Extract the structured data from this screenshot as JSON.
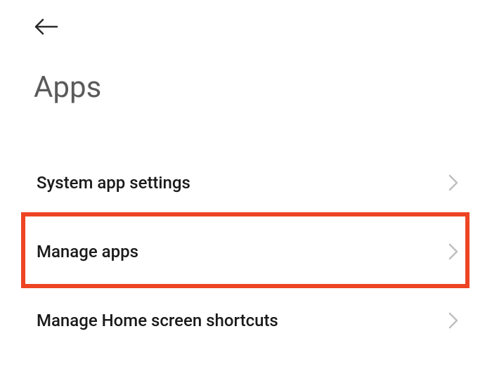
{
  "header": {
    "title": "Apps"
  },
  "items": [
    {
      "label": "System app settings"
    },
    {
      "label": "Manage apps"
    },
    {
      "label": "Manage Home screen shortcuts"
    }
  ],
  "highlight": {
    "color": "#ee4423",
    "target_index": 1
  }
}
